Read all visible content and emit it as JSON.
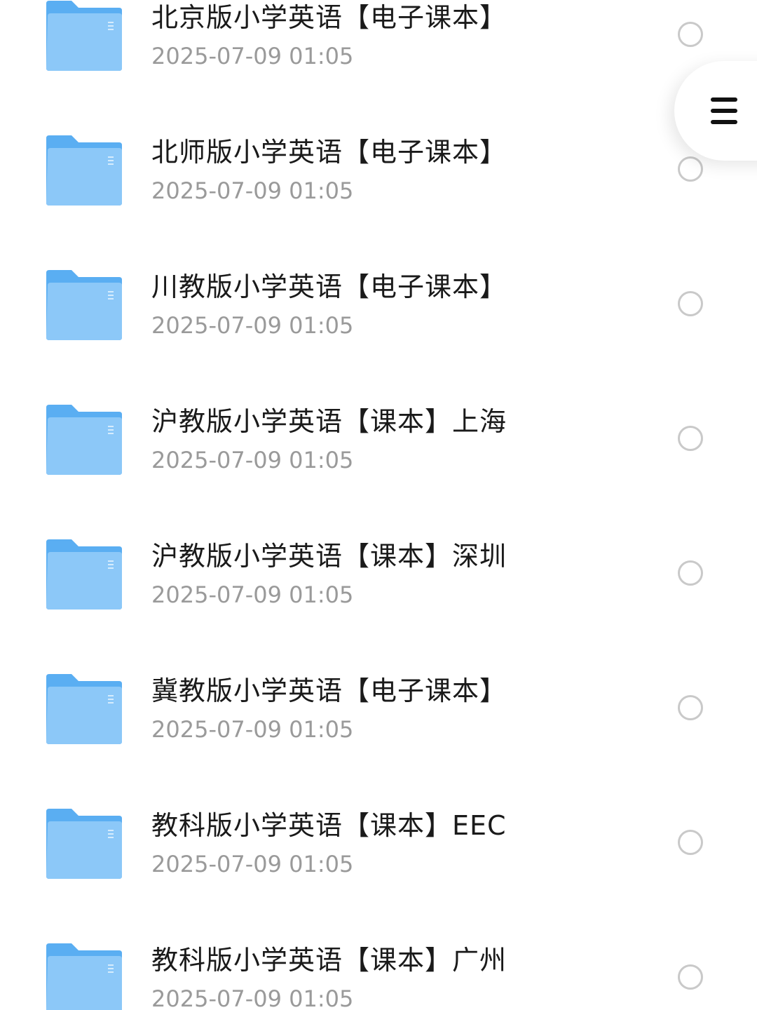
{
  "files": [
    {
      "name": "北京版小学英语【电子课本】",
      "date": "2025-07-09 01:05",
      "icon": "folder-icon"
    },
    {
      "name": "北师版小学英语【电子课本】",
      "date": "2025-07-09 01:05",
      "icon": "folder-icon"
    },
    {
      "name": "川教版小学英语【电子课本】",
      "date": "2025-07-09 01:05",
      "icon": "folder-icon"
    },
    {
      "name": "沪教版小学英语【课本】上海",
      "date": "2025-07-09 01:05",
      "icon": "folder-icon"
    },
    {
      "name": "沪教版小学英语【课本】深圳",
      "date": "2025-07-09 01:05",
      "icon": "folder-icon"
    },
    {
      "name": "冀教版小学英语【电子课本】",
      "date": "2025-07-09 01:05",
      "icon": "folder-icon"
    },
    {
      "name": "教科版小学英语【课本】EEC",
      "date": "2025-07-09 01:05",
      "icon": "folder-icon"
    },
    {
      "name": "教科版小学英语【课本】广州",
      "date": "2025-07-09 01:05",
      "icon": "folder-icon"
    }
  ],
  "menu_button": {
    "icon": "hamburger-menu-icon"
  },
  "colors": {
    "folder_front": "#8cc8f8",
    "folder_back": "#5aaef2",
    "radio_border": "#c9c9c9",
    "date_text": "#9a9a9a"
  }
}
